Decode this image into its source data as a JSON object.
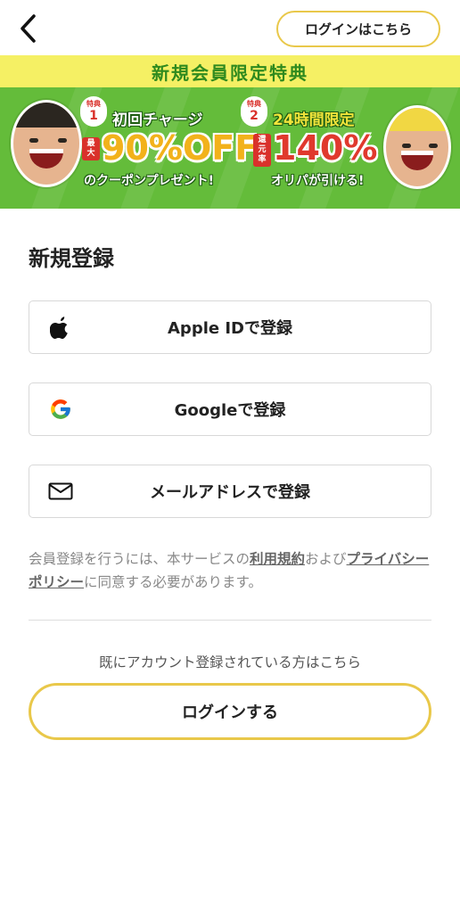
{
  "header": {
    "back_icon": "chevron-left-icon",
    "login_link_label": "ログインはこちら"
  },
  "banner": {
    "headline": "新規会員限定特典",
    "benefit1": {
      "badge_small": "特典",
      "badge_num": "1",
      "title": "初回チャージ",
      "tag": "最大",
      "big": "90%OFF",
      "sub": "のクーポンプレゼント!"
    },
    "benefit2": {
      "badge_small": "特典",
      "badge_num": "2",
      "title": "24時間限定",
      "tag": "還元率",
      "big": "140%",
      "sub": "オリパが引ける!"
    },
    "colors": {
      "head_bg": "#f5f064",
      "body_bg": "#64bc3a",
      "accent_red": "#d9312b"
    }
  },
  "main": {
    "section_title": "新規登録",
    "buttons": [
      {
        "label": "Apple IDで登録",
        "icon": "apple-icon"
      },
      {
        "label": "Googleで登録",
        "icon": "google-icon"
      },
      {
        "label": "メールアドレスで登録",
        "icon": "mail-icon"
      }
    ],
    "terms": {
      "prefix": "会員登録を行うには、本サービスの",
      "terms_link": "利用規約",
      "middle": "および",
      "privacy_link": "プライバシーポリシー",
      "suffix": "に同意する必要があります。"
    },
    "existing_text": "既にアカウント登録されている方はこちら",
    "login_button": "ログインする"
  },
  "colors": {
    "accent_border": "#e9c84a"
  }
}
